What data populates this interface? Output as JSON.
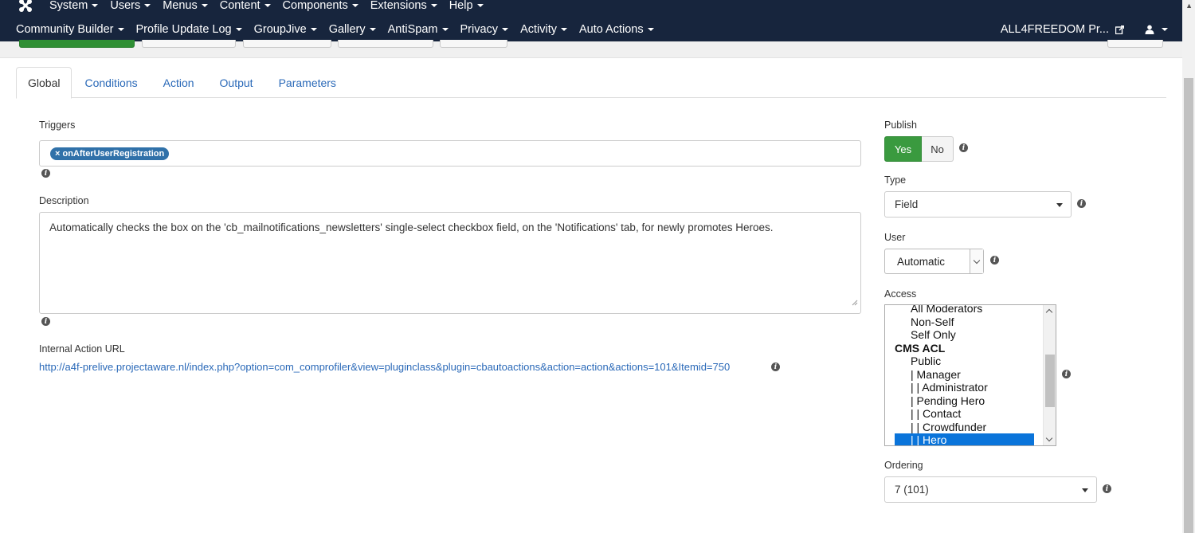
{
  "navbar": {
    "menu_row1": [
      "System",
      "Users",
      "Menus",
      "Content",
      "Components",
      "Extensions",
      "Help"
    ],
    "menu_row2": [
      "Community Builder",
      "Profile Update Log",
      "GroupJive",
      "Gallery",
      "AntiSpam",
      "Privacy",
      "Activity",
      "Auto Actions"
    ],
    "site_name": "ALL4FREEDOM Pr...",
    "colors": {
      "background": "#17253d",
      "text": "#ffffff"
    }
  },
  "tabs": [
    {
      "label": "Global",
      "active": true
    },
    {
      "label": "Conditions",
      "active": false
    },
    {
      "label": "Action",
      "active": false
    },
    {
      "label": "Output",
      "active": false
    },
    {
      "label": "Parameters",
      "active": false
    }
  ],
  "form": {
    "triggers_label": "Triggers",
    "trigger_tag": "× onAfterUserRegistration",
    "description_label": "Description",
    "description_value": "Automatically checks the box on the 'cb_mailnotifications_newsletters' single-select checkbox field, on the 'Notifications' tab, for newly promotes Heroes.",
    "internal_url_label": "Internal Action URL",
    "internal_url": "http://a4f-prelive.projectaware.nl/index.php?option=com_comprofiler&view=pluginclass&plugin=cbautoactions&action=action&actions=101&Itemid=750"
  },
  "sidebar": {
    "publish_label": "Publish",
    "publish_yes": "Yes",
    "publish_no": "No",
    "publish_value": "Yes",
    "type_label": "Type",
    "type_value": "Field",
    "user_label": "User",
    "user_value": "Automatic",
    "access_label": "Access",
    "access_options": [
      {
        "label": "All Moderators",
        "group": false,
        "selected": false
      },
      {
        "label": "Non-Self",
        "group": false,
        "selected": false
      },
      {
        "label": "Self Only",
        "group": false,
        "selected": false
      },
      {
        "label": "CMS ACL",
        "group": true,
        "selected": false
      },
      {
        "label": "Public",
        "group": false,
        "selected": false
      },
      {
        "label": "| Manager",
        "group": false,
        "selected": false
      },
      {
        "label": "| | Administrator",
        "group": false,
        "selected": false
      },
      {
        "label": "| Pending Hero",
        "group": false,
        "selected": false
      },
      {
        "label": "| | Contact",
        "group": false,
        "selected": false
      },
      {
        "label": "| | Crowdfunder",
        "group": false,
        "selected": false
      },
      {
        "label": "| | Hero",
        "group": false,
        "selected": true
      }
    ],
    "ordering_label": "Ordering",
    "ordering_value": "7 (101)",
    "colors": {
      "publish_yes": "#3a9a3f",
      "selected_option": "#0a74da",
      "link": "#2a69b8"
    }
  },
  "icons": [
    "joomla-logo",
    "caret-down",
    "external-link-icon",
    "user-icon",
    "info-icon",
    "resize-grip"
  ]
}
